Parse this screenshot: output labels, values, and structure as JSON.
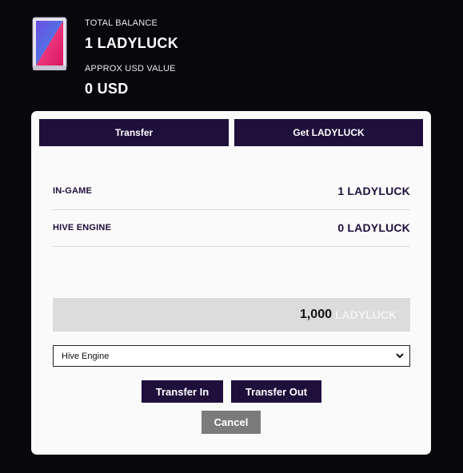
{
  "header": {
    "total_balance_label": "TOTAL BALANCE",
    "total_balance_value": "1 LADYLUCK",
    "usd_label": "APPROX USD VALUE",
    "usd_value": "0 USD",
    "token_icon": "playing-card-icon"
  },
  "tabs": [
    {
      "label": "Transfer"
    },
    {
      "label": "Get LADYLUCK"
    }
  ],
  "balances": [
    {
      "label": "IN-GAME",
      "value": "1 LADYLUCK"
    },
    {
      "label": "HIVE ENGINE",
      "value": "0 LADYLUCK"
    }
  ],
  "amount": {
    "value": "1,000",
    "unit": "LADYLUCK"
  },
  "destination_select": {
    "selected": "Hive Engine"
  },
  "actions": {
    "transfer_in": "Transfer In",
    "transfer_out": "Transfer Out",
    "cancel": "Cancel"
  },
  "colors": {
    "background": "#07070c",
    "accent": "#1e0f3b",
    "panel": "#fafafa",
    "cancel": "#7b7b7b"
  }
}
